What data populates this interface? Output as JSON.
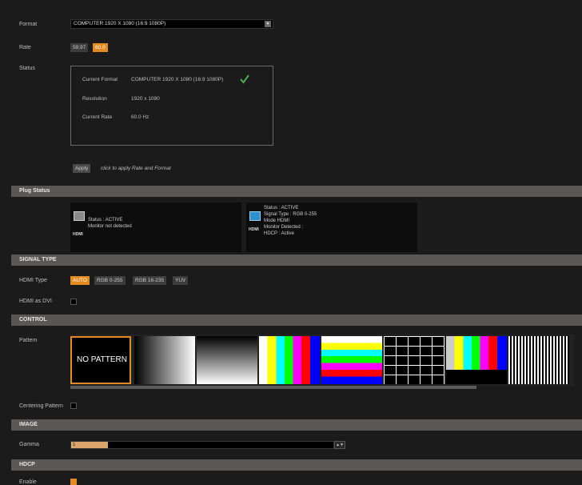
{
  "format": {
    "label": "Format",
    "value": "COMPUTER 1920 X 1080 (16:9 1080P)"
  },
  "rate": {
    "label": "Rate",
    "options": [
      "59.97",
      "60.0"
    ],
    "selected": "60.0"
  },
  "status": {
    "label": "Status",
    "current_format_label": "Current Format",
    "current_format_value": "COMPUTER 1920 X 1080 (16:9 1080P)",
    "resolution_label": "Resolution",
    "resolution_value": "1920 x 1080",
    "current_rate_label": "Current Rate",
    "current_rate_value": "60.0 Hz"
  },
  "apply": {
    "button": "Apply",
    "hint": "click to apply Rate and Format"
  },
  "plug_status": {
    "title": "Plug Status",
    "sdi": {
      "icon_label": "HDMI",
      "lines": [
        "Status : ACTIVE",
        "Monitor not detected"
      ]
    },
    "hdmi": {
      "icon_label": "HDMI",
      "lines": [
        "Status : ACTIVE",
        "Signal Type : RGB 0-255",
        "Mode HDMI",
        "Monitor Detected :",
        "HDCP : Active"
      ]
    }
  },
  "signal_type": {
    "title": "SIGNAL TYPE",
    "hdmi_type_label": "HDMI Type",
    "hdmi_type_options": [
      "AUTO",
      "RGB 0-255",
      "RGB 16-235",
      "YUV"
    ],
    "hdmi_type_selected": "AUTO",
    "hdmi_as_dvi_label": "HDMI as DVI",
    "hdmi_as_dvi_checked": false
  },
  "control": {
    "title": "CONTROL",
    "pattern_label": "Pattern",
    "patterns": [
      "NO PATTERN",
      "gradient-horizontal",
      "gradient-vertical-steps",
      "color-bars",
      "color-stripes-horizontal",
      "grid",
      "smpte-bars",
      "multiburst"
    ],
    "selected_pattern": "NO PATTERN",
    "centering_label": "Centering Pattern",
    "centering_checked": false
  },
  "image": {
    "title": "IMAGE",
    "gamma_label": "Gamma",
    "gamma_value": "1",
    "gamma_fraction": 0.14
  },
  "hdcp": {
    "title": "HDCP",
    "enable_label": "Enable",
    "enable_checked": true
  },
  "colors": {
    "accent": "#e58a1f",
    "section_bar": "#5a5757",
    "background": "#1b1b1b"
  }
}
